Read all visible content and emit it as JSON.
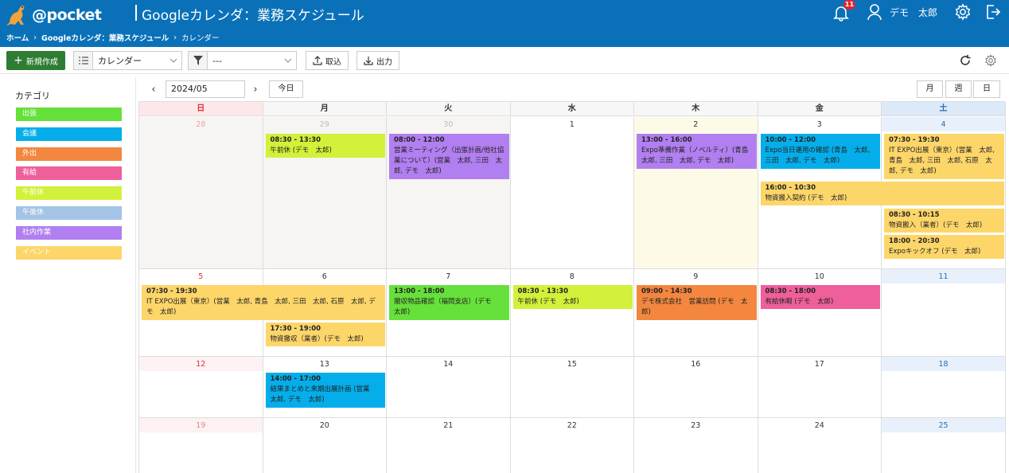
{
  "header": {
    "logo_text": "@pocket",
    "title": "Googleカレンダ：業務スケジュール",
    "notification_count": "11",
    "user_name": "デモ　太郎"
  },
  "breadcrumb": {
    "home": "ホーム",
    "parent": "Googleカレンダ：業務スケジュール",
    "current": "カレンダー"
  },
  "toolbar": {
    "new_label": "新規作成",
    "view_select": "カレンダー",
    "filter_select": "---",
    "import_label": "取込",
    "export_label": "出力"
  },
  "sidebar": {
    "title": "カテゴリ",
    "categories": [
      {
        "label": "出張",
        "color": "#66e03a"
      },
      {
        "label": "会議",
        "color": "#05aeea"
      },
      {
        "label": "外出",
        "color": "#f3873f"
      },
      {
        "label": "有給",
        "color": "#ef5f9a"
      },
      {
        "label": "午前休",
        "color": "#d3f03a"
      },
      {
        "label": "午後休",
        "color": "#a3c4e6"
      },
      {
        "label": "社内作業",
        "color": "#b17ff0"
      },
      {
        "label": "イベント",
        "color": "#fdd66a"
      }
    ]
  },
  "calendar": {
    "month": "2024/05",
    "today_label": "今日",
    "views": [
      "月",
      "週",
      "日"
    ],
    "weekdays": [
      "日",
      "月",
      "火",
      "水",
      "木",
      "金",
      "土"
    ],
    "weeks": [
      [
        "28",
        "29",
        "30",
        "1",
        "2",
        "3",
        "4"
      ],
      [
        "5",
        "6",
        "7",
        "8",
        "9",
        "10",
        "11"
      ],
      [
        "12",
        "13",
        "14",
        "15",
        "16",
        "17",
        "18"
      ],
      [
        "19",
        "20",
        "21",
        "22",
        "23",
        "24",
        "25"
      ]
    ],
    "events": [
      {
        "time": "08:30 - 13:30",
        "title": "午前休 (デモ　太郎)",
        "color": "#d3f03a"
      },
      {
        "time": "08:00 - 12:00",
        "title": "営業ミーティング（出張計画/他社協業について）(営業　太郎, 三田　太郎, デモ　太郎)",
        "color": "#b17ff0"
      },
      {
        "time": "13:00 - 16:00",
        "title": "Expo準備作業（ノベルティ）(青島　太郎, 三田　太郎, デモ　太郎)",
        "color": "#b17ff0"
      },
      {
        "time": "10:00 - 12:00",
        "title": "Expo当日運用の確認 (青島　太郎, 三田　太郎, デモ　太郎)",
        "color": "#05aeea"
      },
      {
        "time": "07:30 - 19:30",
        "title": "IT EXPO出展（東京）(営業　太郎, 青島　太郎, 三田　太郎, 石原　太郎, デモ　太郎)",
        "color": "#fdd66a"
      },
      {
        "time": "16:00 - 10:30",
        "title": "物資搬入契約 (デモ　太郎)",
        "color": "#fdd66a"
      },
      {
        "time": "08:30 - 10:15",
        "title": "物資搬入（業者）(デモ　太郎)",
        "color": "#fdd66a"
      },
      {
        "time": "18:00 - 20:30",
        "title": "Expoキックオフ (デモ　太郎)",
        "color": "#fdd66a"
      },
      {
        "time": "07:30 - 19:30",
        "title": "IT EXPO出展（東京）(営業　太郎, 青島　太郎, 三田　太郎, 石原　太郎, デモ　太郎)",
        "color": "#fdd66a"
      },
      {
        "time": "17:30 - 19:00",
        "title": "物資撤収（業者）(デモ　太郎)",
        "color": "#fdd66a"
      },
      {
        "time": "13:00 - 18:00",
        "title": "撤収物品確認（福岡支店）(デモ　太郎)",
        "color": "#66e03a"
      },
      {
        "time": "08:30 - 13:30",
        "title": "午前休 (デモ　太郎)",
        "color": "#d3f03a"
      },
      {
        "time": "09:00 - 14:30",
        "title": "デモ株式会社　営業訪問 (デモ　太郎)",
        "color": "#f3873f"
      },
      {
        "time": "08:30 - 18:00",
        "title": "有給休暇 (デモ　太郎)",
        "color": "#ef5f9a"
      },
      {
        "time": "14:00 - 17:00",
        "title": "結果まとめと来期出展計画 (営業　太郎, デモ　太郎)",
        "color": "#05aeea"
      }
    ]
  }
}
